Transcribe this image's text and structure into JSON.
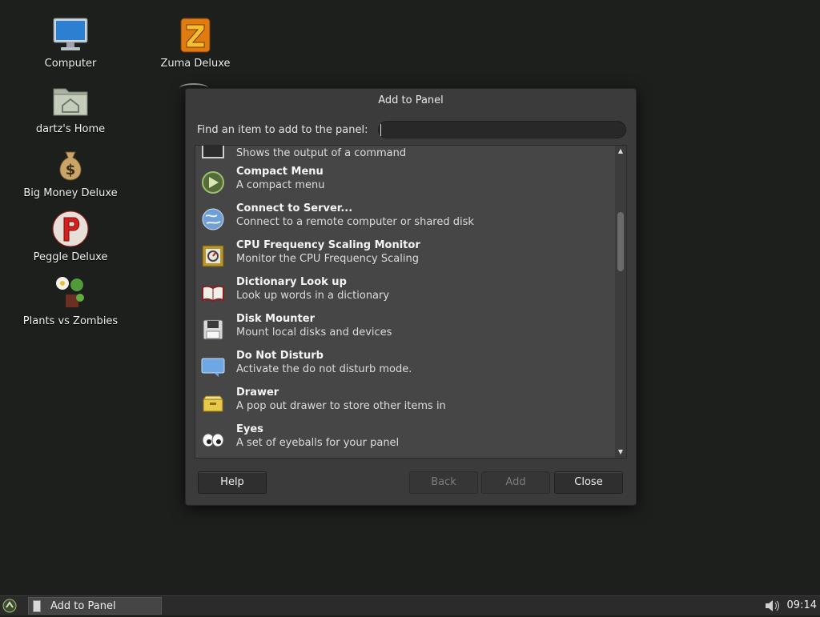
{
  "desktop": {
    "icons": [
      {
        "label": "Computer",
        "icon": "computer-icon"
      },
      {
        "label": "Zuma Deluxe",
        "icon": "zuma-icon"
      },
      {
        "label": "dartz's Home",
        "icon": "home-folder-icon"
      },
      {
        "label": "Big Money Deluxe",
        "icon": "money-bag-icon"
      },
      {
        "label": "Peggle Deluxe",
        "icon": "peggle-icon"
      },
      {
        "label": "Plants vs Zombies",
        "icon": "plants-icon"
      }
    ]
  },
  "dialog": {
    "title": "Add to Panel",
    "find_label": "Find an item to add to the panel:",
    "find_value": "",
    "items": [
      {
        "name": "",
        "desc": "Shows the output of a command",
        "icon": "command-icon"
      },
      {
        "name": "Compact Menu",
        "desc": "A compact menu",
        "icon": "compact-menu-icon"
      },
      {
        "name": "Connect to Server...",
        "desc": "Connect to a remote computer or shared disk",
        "icon": "globe-icon"
      },
      {
        "name": "CPU Frequency Scaling Monitor",
        "desc": "Monitor the CPU Frequency Scaling",
        "icon": "cpu-icon"
      },
      {
        "name": "Dictionary Look up",
        "desc": "Look up words in a dictionary",
        "icon": "book-icon"
      },
      {
        "name": "Disk Mounter",
        "desc": "Mount local disks and devices",
        "icon": "floppy-disk-icon"
      },
      {
        "name": "Do Not Disturb",
        "desc": "Activate the do not disturb mode.",
        "icon": "notification-icon"
      },
      {
        "name": "Drawer",
        "desc": "A pop out drawer to store other items in",
        "icon": "drawer-icon"
      },
      {
        "name": "Eyes",
        "desc": "A set of eyeballs for your panel",
        "icon": "eyes-icon"
      }
    ],
    "buttons": {
      "help": "Help",
      "back": "Back",
      "add": "Add",
      "close": "Close"
    }
  },
  "taskbar": {
    "task_label": "Add to Panel",
    "clock": "09:14"
  }
}
